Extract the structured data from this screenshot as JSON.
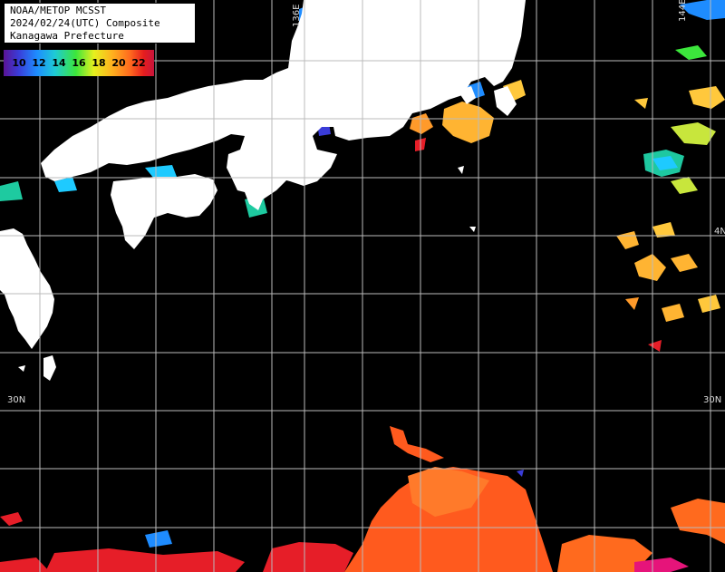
{
  "title": {
    "line1": "NOAA/METOP MCSST",
    "line2": "2024/02/24(UTC) Composite",
    "line3": "Kanagawa Prefecture"
  },
  "legend": {
    "values": [
      "10",
      "12",
      "14",
      "16",
      "18",
      "20",
      "22"
    ]
  },
  "axis_labels": {
    "lon_136": "136E",
    "lon_144": "144E",
    "lat_30_left": "30N",
    "lat_30_right": "30N",
    "lat_34_right": "4N"
  },
  "colors": {
    "land": "#ffffff",
    "sea_no_data": "#000000",
    "grid": "#cccccc",
    "warm_sst": "#ff5a1e",
    "hot_sst": "#e61e28",
    "cool_sst": "#ffb432",
    "cold_sst": "#1ec8ff"
  }
}
